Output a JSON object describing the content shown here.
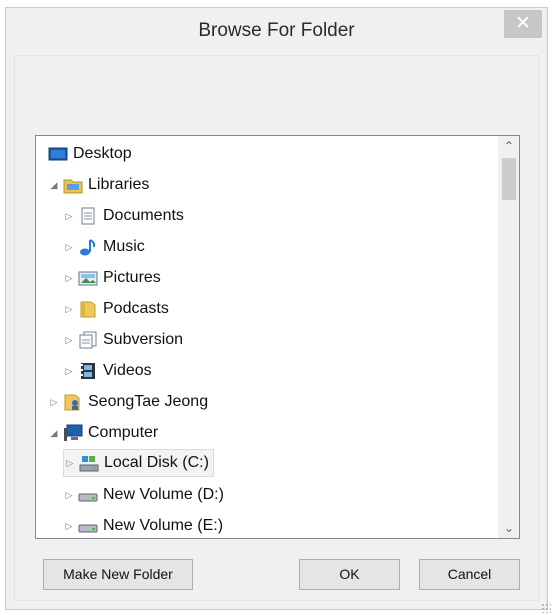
{
  "window": {
    "title": "Browse For Folder",
    "close_glyph": "✕"
  },
  "tree": {
    "items": [
      {
        "label": "Desktop",
        "expander": "",
        "icon": "desktop-icon"
      },
      {
        "label": "Libraries",
        "expander": "◢",
        "icon": "libraries-folder-icon"
      },
      {
        "label": "Documents",
        "expander": "▷",
        "icon": "documents-icon"
      },
      {
        "label": "Music",
        "expander": "▷",
        "icon": "music-icon"
      },
      {
        "label": "Pictures",
        "expander": "▷",
        "icon": "pictures-icon"
      },
      {
        "label": "Podcasts",
        "expander": "▷",
        "icon": "folder-icon"
      },
      {
        "label": "Subversion",
        "expander": "▷",
        "icon": "documents-library-icon"
      },
      {
        "label": "Videos",
        "expander": "▷",
        "icon": "videos-icon"
      },
      {
        "label": "SeongTae Jeong",
        "expander": "▷",
        "icon": "user-folder-icon"
      },
      {
        "label": "Computer",
        "expander": "◢",
        "icon": "computer-icon"
      },
      {
        "label": "Local Disk (C:)",
        "expander": "▷",
        "icon": "system-drive-icon",
        "selected": true
      },
      {
        "label": "New Volume (D:)",
        "expander": "▷",
        "icon": "drive-icon"
      },
      {
        "label": "New Volume (E:)",
        "expander": "▷",
        "icon": "drive-icon"
      }
    ],
    "scroll_up_glyph": "⌃",
    "scroll_down_glyph": "⌄"
  },
  "buttons": {
    "make_new_folder": "Make New Folder",
    "ok": "OK",
    "cancel": "Cancel"
  }
}
